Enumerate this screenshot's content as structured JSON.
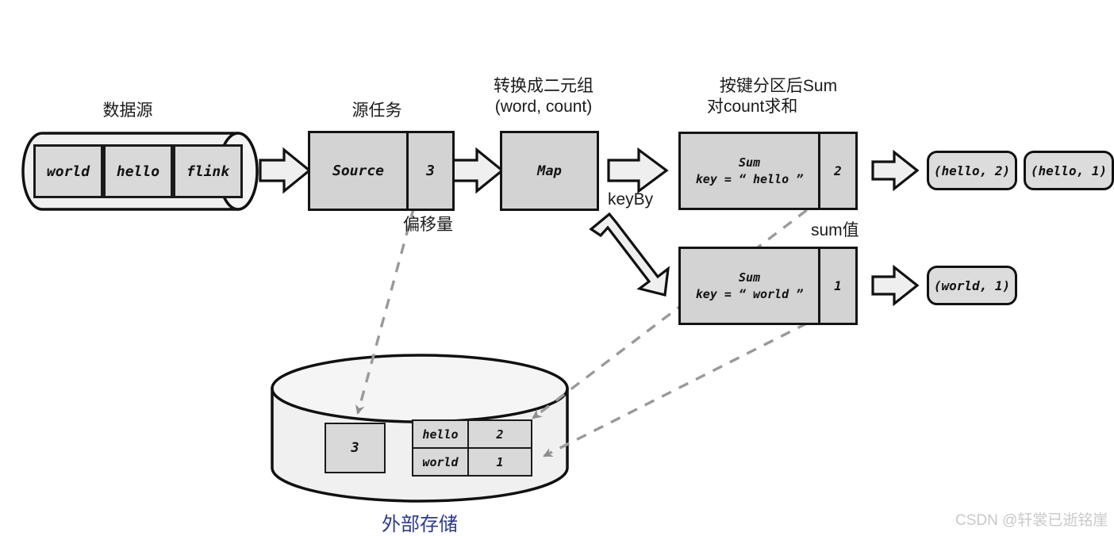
{
  "diagram": {
    "title_source": "数据源",
    "title_source_task": "源任务",
    "title_map_line1": "转换成二元组",
    "title_map_line2": "(word, count)",
    "title_sum_line1": "按键分区后Sum",
    "title_sum_line2": "对count求和",
    "label_offset": "偏移量",
    "label_keyby": "keyBy",
    "label_sumvalue": "sum值",
    "label_storage": "外部存储",
    "watermark": "CSDN @轩裳已逝铭崖",
    "accent_storage_color": "#2b3a8f",
    "box_fill": "#d3d3d3",
    "outline": "#141414"
  },
  "source": {
    "records": [
      {
        "text": "world"
      },
      {
        "text": "hello"
      },
      {
        "text": "flink"
      }
    ]
  },
  "source_task": {
    "op_label": "Source",
    "offset_value": "3"
  },
  "map_task": {
    "op_label": "Map"
  },
  "sum_tasks": [
    {
      "op_line1": "Sum",
      "op_line2": "key = “ hello ”",
      "value": "2"
    },
    {
      "op_line1": "Sum",
      "op_line2": "key = “ world ”",
      "value": "1"
    }
  ],
  "outputs": [
    {
      "text": "(hello, 2)"
    },
    {
      "text": "(hello, 1)"
    },
    {
      "text": "(world, 1)"
    }
  ],
  "storage": {
    "offset_cell": "3",
    "table": {
      "rows": [
        {
          "key": "hello",
          "value": "2"
        },
        {
          "key": "world",
          "value": "1"
        }
      ]
    }
  }
}
